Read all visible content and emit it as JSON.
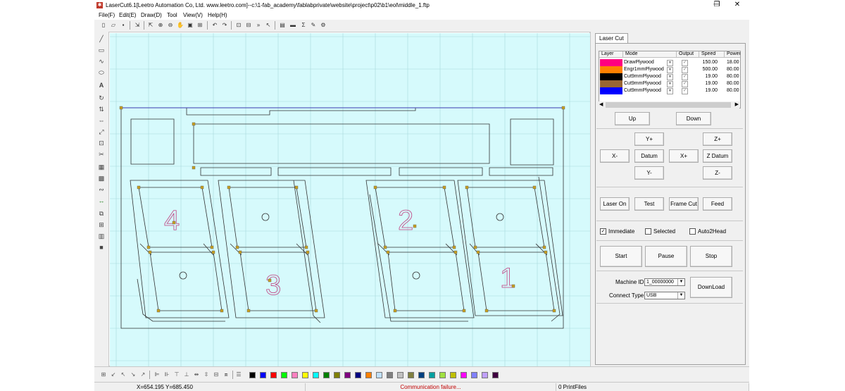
{
  "window": {
    "title": "LaserCut6.1[Leetro Automation Co, Ltd. www.leetro.com]--c:\\1-fab_academy\\fablabprivate\\website\\project\\p02\\b1\\eol\\middle_1.ftp",
    "minimize": "─",
    "restore": "❐",
    "close": "✕"
  },
  "menu": [
    "File(F)",
    "Edit(E)",
    "Draw(D)",
    "Tool",
    "View(V)",
    "Help(H)"
  ],
  "panel": {
    "tab": "Laser Cut",
    "layer_headers": [
      "Layer",
      "Mode",
      "Output",
      "Speed",
      "Power"
    ],
    "layers": [
      {
        "color": "#ff0080",
        "mode": "DrawPlywood",
        "output": true,
        "speed": "150.00",
        "power": "18.00"
      },
      {
        "color": "#ff8000",
        "mode": "Engr1mmPlywood",
        "output": true,
        "speed": "500.00",
        "power": "80.00"
      },
      {
        "color": "#000000",
        "mode": "Cut9mmPlywood",
        "output": true,
        "speed": "19.00",
        "power": "80.00"
      },
      {
        "color": "#996633",
        "mode": "Cut9mmPlywood",
        "output": true,
        "speed": "19.00",
        "power": "80.00"
      },
      {
        "color": "#0000ff",
        "mode": "Cut9mmPlywood",
        "output": true,
        "speed": "19.00",
        "power": "80.00"
      }
    ],
    "scroll_left": "◀",
    "scroll_right": "▶",
    "buttons": {
      "up": "Up",
      "down": "Down",
      "y_plus": "Y+",
      "z_plus": "Z+",
      "x_minus": "X-",
      "datum": "Datum",
      "x_plus": "X+",
      "z_datum": "Z Datum",
      "y_minus": "Y-",
      "z_minus": "Z-",
      "laser_on": "Laser On",
      "test": "Test",
      "frame_cut": "Frame Cut",
      "feed": "Feed",
      "start": "Start",
      "pause": "Pause",
      "stop": "Stop",
      "download": "DownLoad"
    },
    "options": {
      "immediate": {
        "label": "Immediate",
        "checked": true
      },
      "selected": {
        "label": "Selected",
        "checked": false
      },
      "auto2head": {
        "label": "Auto2Head",
        "checked": false
      }
    },
    "machine_id_label": "Machine ID:",
    "machine_id_value": "1_00000000",
    "connect_type_label": "Connect Type:",
    "connect_type_value": "USB"
  },
  "canvas": {
    "digits": [
      "4",
      "3",
      "2",
      "1"
    ],
    "colors": {
      "background": "#d6fafc",
      "grid": "#a8d8dc",
      "frame": "#ffffff",
      "cut_line": "#333333",
      "engrave_line": "#c04080",
      "top_line": "#3a3ab0",
      "marker": "#c8a020"
    }
  },
  "palette": [
    "#000000",
    "#0000ff",
    "#ff0000",
    "#00ff00",
    "#ff80c0",
    "#ffff00",
    "#00ffff",
    "#008000",
    "#808000",
    "#800080",
    "#000080",
    "#ff8000",
    "#c0e0ff",
    "#808080",
    "#c0c0c0",
    "#808040",
    "#004080",
    "#00a0a0",
    "#a0e040",
    "#c0c000",
    "#ff00ff",
    "#8080ff",
    "#c0a0ff",
    "#400040"
  ],
  "status": {
    "coords": "X=654.195 Y=685.450",
    "message": "Communication failure...",
    "files": "0 PrintFiles"
  }
}
